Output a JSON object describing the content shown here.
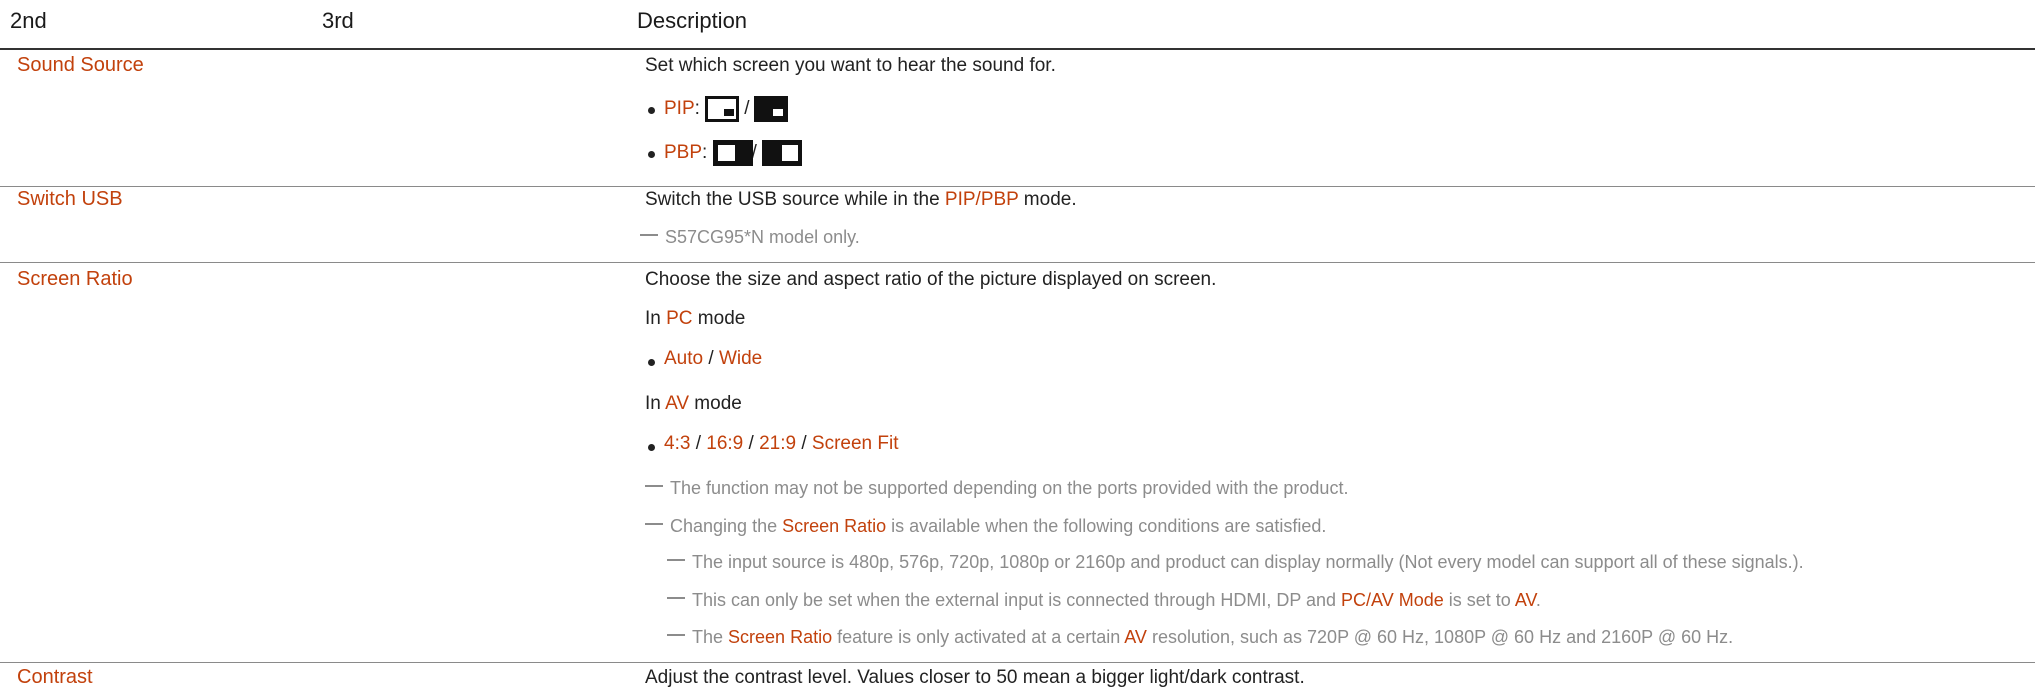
{
  "header": {
    "col1": "2nd",
    "col2": "3rd",
    "col3": "Description"
  },
  "rows": {
    "sound_source": {
      "label": "Sound Source",
      "desc": "Set which screen you want to hear the sound for.",
      "pip_label": "PIP",
      "pbp_label": "PBP",
      "colon": ":",
      "slash": "/"
    },
    "switch_usb": {
      "label": "Switch USB",
      "desc_pre": "Switch the USB source while in the ",
      "desc_hl": "PIP/PBP",
      "desc_post": " mode.",
      "note": "S57CG95*N model only."
    },
    "screen_ratio": {
      "label": "Screen Ratio",
      "desc": "Choose the size and aspect ratio of the picture displayed on screen.",
      "in": "In ",
      "pc": "PC",
      "av": "AV",
      "mode": " mode",
      "pc_opt1": "Auto",
      "pc_opt2": "Wide",
      "av_opt1": "4:3",
      "av_opt2": "16:9",
      "av_opt3": "21:9",
      "av_opt4": "Screen Fit",
      "sep": " / ",
      "note1": "The function may not be supported depending on the ports provided with the product.",
      "note2_pre": "Changing the ",
      "note2_hl": "Screen Ratio",
      "note2_post": " is available when the following conditions are satisfied.",
      "sub1": "The input source is 480p, 576p, 720p, 1080p or 2160p and product can display normally (Not every model can support all of these signals.).",
      "sub2_pre": "This can only be set when the external input is connected through HDMI, DP and ",
      "sub2_hl1": "PC/AV Mode",
      "sub2_mid": " is set to ",
      "sub2_hl2": "AV",
      "sub2_end": ".",
      "sub3_pre": "The ",
      "sub3_hl1": "Screen Ratio",
      "sub3_mid": " feature is only activated at a certain ",
      "sub3_hl2": "AV",
      "sub3_post": " resolution, such as 720P @ 60 Hz, 1080P @ 60 Hz and 2160P @ 60 Hz."
    },
    "contrast": {
      "label": "Contrast",
      "desc": "Adjust the contrast level. Values closer to 50 mean a bigger light/dark contrast."
    }
  },
  "colors": {
    "accent": "#c2410c",
    "note": "#8c8c8c"
  }
}
